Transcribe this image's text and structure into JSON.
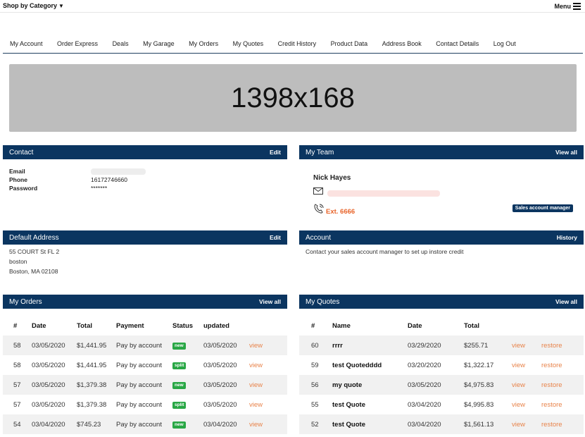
{
  "topbar": {
    "shop_label": "Shop by Category",
    "menu_label": "Menu"
  },
  "nav": [
    "My Account",
    "Order Express",
    "Deals",
    "My Garage",
    "My Orders",
    "My Quotes",
    "Credit History",
    "Product Data",
    "Address Book",
    "Contact Details",
    "Log Out"
  ],
  "banner": {
    "text": "1398x168"
  },
  "contact": {
    "title": "Contact",
    "action": "Edit",
    "email_label": "Email",
    "phone_label": "Phone",
    "phone_value": "16172746660",
    "password_label": "Password",
    "password_value": "*******"
  },
  "team": {
    "title": "My Team",
    "action": "View all",
    "name": "Nick Hayes",
    "ext": "Ext. 6666",
    "role_badge": "Sales account manager"
  },
  "default_address": {
    "title": "Default Address",
    "action": "Edit",
    "line1": "55 COURT St FL 2",
    "line2": "boston",
    "line3": "Boston, MA 02108"
  },
  "account": {
    "title": "Account",
    "action": "History",
    "message": "Contact your sales account manager to set up instore credit"
  },
  "orders": {
    "title": "My Orders",
    "action": "View all",
    "headers": [
      "#",
      "Date",
      "Total",
      "Payment",
      "Status",
      "updated",
      ""
    ],
    "rows": [
      {
        "num": "58",
        "date": "03/05/2020",
        "total": "$1,441.95",
        "payment": "Pay by account",
        "status": "new",
        "updated": "03/05/2020",
        "link": "view"
      },
      {
        "num": "58",
        "date": "03/05/2020",
        "total": "$1,441.95",
        "payment": "Pay by account",
        "status": "split",
        "updated": "03/05/2020",
        "link": "view"
      },
      {
        "num": "57",
        "date": "03/05/2020",
        "total": "$1,379.38",
        "payment": "Pay by account",
        "status": "new",
        "updated": "03/05/2020",
        "link": "view"
      },
      {
        "num": "57",
        "date": "03/05/2020",
        "total": "$1,379.38",
        "payment": "Pay by account",
        "status": "split",
        "updated": "03/05/2020",
        "link": "view"
      },
      {
        "num": "54",
        "date": "03/04/2020",
        "total": "$745.23",
        "payment": "Pay by account",
        "status": "new",
        "updated": "03/04/2020",
        "link": "view"
      }
    ]
  },
  "quotes": {
    "title": "My Quotes",
    "action": "View all",
    "headers": [
      "#",
      "Name",
      "Date",
      "Total",
      "",
      ""
    ],
    "rows": [
      {
        "num": "60",
        "name": "rrrr",
        "date": "03/29/2020",
        "total": "$255.71",
        "view": "view",
        "restore": "restore"
      },
      {
        "num": "59",
        "name": "test Quotedddd",
        "date": "03/20/2020",
        "total": "$1,322.17",
        "view": "view",
        "restore": "restore"
      },
      {
        "num": "56",
        "name": "my quote",
        "date": "03/05/2020",
        "total": "$4,975.83",
        "view": "view",
        "restore": "restore"
      },
      {
        "num": "55",
        "name": "test Quote",
        "date": "03/04/2020",
        "total": "$4,995.83",
        "view": "view",
        "restore": "restore"
      },
      {
        "num": "52",
        "name": "test Quote",
        "date": "03/04/2020",
        "total": "$1,561.13",
        "view": "view",
        "restore": "restore"
      }
    ]
  },
  "colors": {
    "header_bg": "#0b3560",
    "link": "#e8834a",
    "badge": "#29a745",
    "ext": "#e8642a"
  }
}
